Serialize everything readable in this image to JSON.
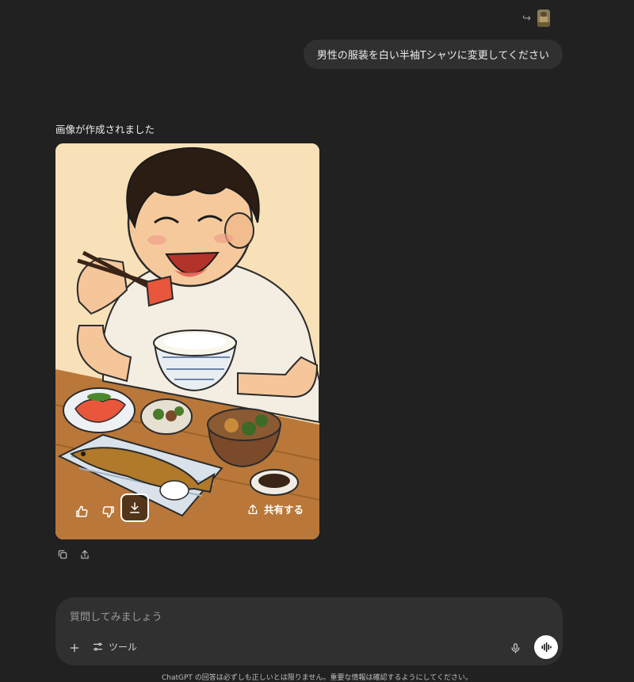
{
  "conversation": {
    "reference": {
      "arrow_glyph": "↪",
      "thumbnail": "reference-image-thumbnail"
    },
    "user_message": "男性の服装を白い半袖Tシャツに変更してください",
    "assistant_caption": "画像が作成されました",
    "image_actions": {
      "share_label": "共有する"
    }
  },
  "composer": {
    "placeholder": "質問してみましょう",
    "tools_label": "ツール"
  },
  "footer": {
    "disclaimer": "ChatGPT の回答は必ずしも正しいとは限りません。重要な情報は確認するようにしてください。"
  },
  "colors": {
    "background": "#212121",
    "bubble": "#303030",
    "composer": "#303030"
  }
}
